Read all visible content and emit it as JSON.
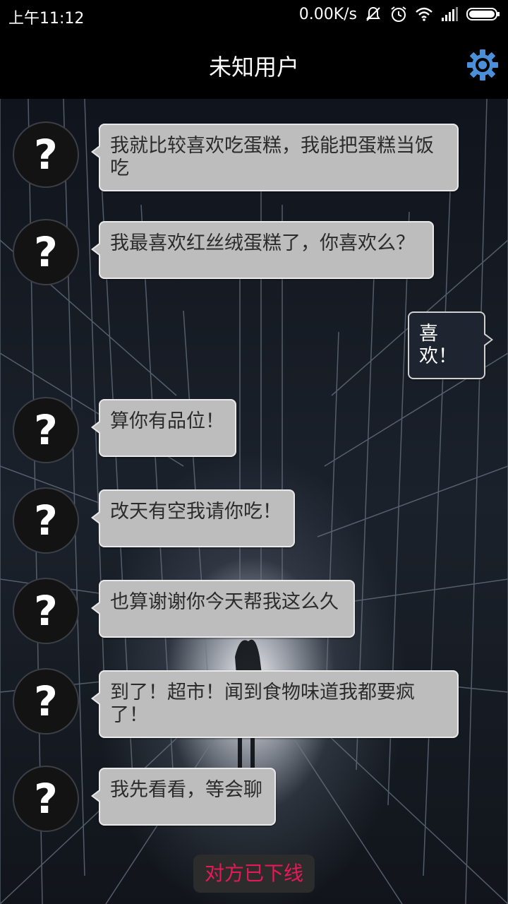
{
  "status_bar": {
    "time": "上午11:12",
    "speed": "0.00K/s",
    "icons": [
      "mute-icon",
      "alarm-icon",
      "wifi-icon",
      "signal-icon",
      "battery-icon"
    ]
  },
  "header": {
    "title": "未知用户",
    "settings_icon": "gear-icon",
    "accent_color": "#4a8fd8"
  },
  "avatar_glyph": "?",
  "messages": [
    {
      "from": "other",
      "text": "我就比较喜欢吃蛋糕，我能把蛋糕当饭吃"
    },
    {
      "from": "other",
      "text": "我最喜欢红丝绒蛋糕了，你喜欢么？"
    },
    {
      "from": "me",
      "text": "喜欢！"
    },
    {
      "from": "other",
      "text": "算你有品位！"
    },
    {
      "from": "other",
      "text": "改天有空我请你吃！"
    },
    {
      "from": "other",
      "text": "也算谢谢你今天帮我这么久"
    },
    {
      "from": "other",
      "text": "到了！超市！闻到食物味道我都要疯了！"
    },
    {
      "from": "other",
      "text": "我先看看，等会聊"
    }
  ],
  "footer": {
    "status_text": "对方已下线",
    "status_color": "#e5195a"
  }
}
